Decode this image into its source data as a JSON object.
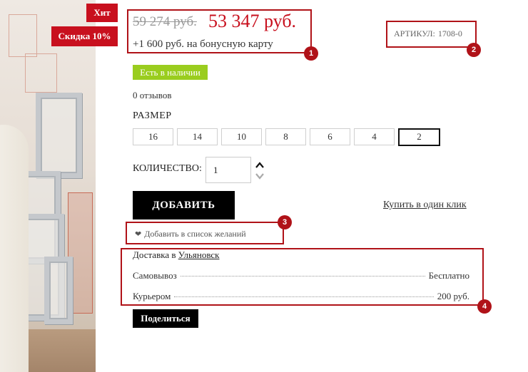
{
  "badges": {
    "hit": "Хит",
    "sale": "Скидка 10%"
  },
  "price": {
    "old": "59 274 руб.",
    "new": "53 347 руб.",
    "bonus": "+1 600 руб. на бонусную карту"
  },
  "article": {
    "label": "АРТИКУЛ:",
    "value": "1708-0"
  },
  "stock": "Есть в наличии",
  "reviews": "0 отзывов",
  "size": {
    "label": "РАЗМЕР",
    "options": [
      "16",
      "14",
      "10",
      "8",
      "6",
      "4",
      "2"
    ],
    "selected": "2"
  },
  "quantity": {
    "label": "КОЛИЧЕСТВО:",
    "value": "1"
  },
  "actions": {
    "add": "ДОБАВИТЬ",
    "one_click": "Купить в один клик",
    "wishlist": "Добавить в список желаний"
  },
  "delivery": {
    "title": "Доставка в",
    "city": "Ульяновск",
    "options": [
      {
        "method": "Самовывоз",
        "price": "Бесплатно"
      },
      {
        "method": "Курьером",
        "price": "200 руб."
      }
    ]
  },
  "share": "Поделиться",
  "annotations": [
    "1",
    "2",
    "3",
    "4"
  ],
  "colors": {
    "accent_red": "#c8101e",
    "stock_green": "#9acd1f",
    "annotation": "#b01218"
  }
}
